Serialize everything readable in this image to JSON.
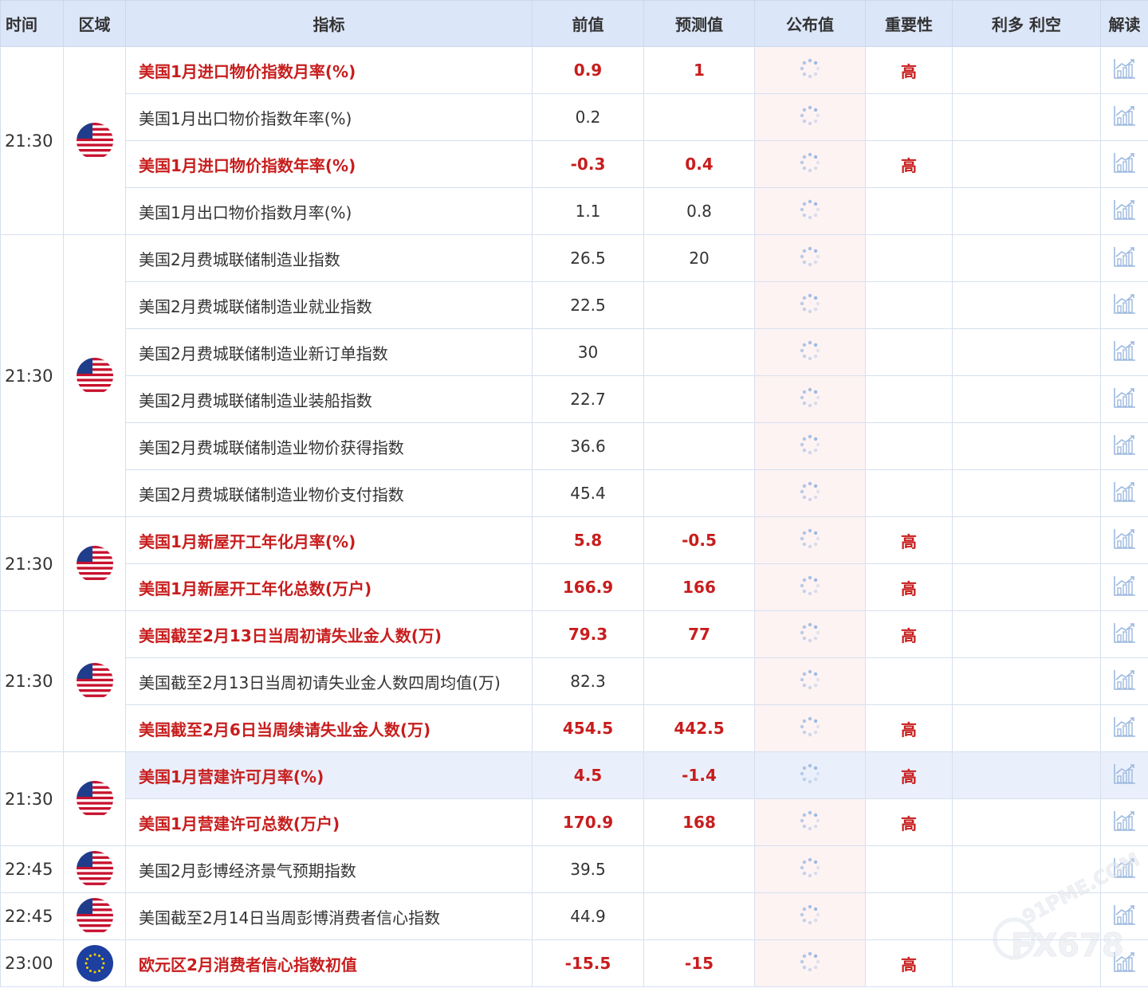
{
  "header": {
    "time": "时间",
    "region": "区域",
    "indicator": "指标",
    "previous": "前值",
    "forecast": "预测值",
    "published": "公布值",
    "importance": "重要性",
    "effect": "利多 利空",
    "interpret": "解读"
  },
  "groups": [
    {
      "time": "21:30",
      "region": "us",
      "rows": [
        {
          "name": "美国1月进口物价指数月率(%)",
          "prev": "0.9",
          "fc": "1",
          "imp": "高",
          "hi": true
        },
        {
          "name": "美国1月出口物价指数年率(%)",
          "prev": "0.2",
          "fc": "",
          "imp": "",
          "hi": false
        },
        {
          "name": "美国1月进口物价指数年率(%)",
          "prev": "-0.3",
          "fc": "0.4",
          "imp": "高",
          "hi": true
        },
        {
          "name": "美国1月出口物价指数月率(%)",
          "prev": "1.1",
          "fc": "0.8",
          "imp": "",
          "hi": false
        }
      ]
    },
    {
      "time": "21:30",
      "region": "us",
      "rows": [
        {
          "name": "美国2月费城联储制造业指数",
          "prev": "26.5",
          "fc": "20",
          "imp": "",
          "hi": false
        },
        {
          "name": "美国2月费城联储制造业就业指数",
          "prev": "22.5",
          "fc": "",
          "imp": "",
          "hi": false
        },
        {
          "name": "美国2月费城联储制造业新订单指数",
          "prev": "30",
          "fc": "",
          "imp": "",
          "hi": false
        },
        {
          "name": "美国2月费城联储制造业装船指数",
          "prev": "22.7",
          "fc": "",
          "imp": "",
          "hi": false
        },
        {
          "name": "美国2月费城联储制造业物价获得指数",
          "prev": "36.6",
          "fc": "",
          "imp": "",
          "hi": false
        },
        {
          "name": "美国2月费城联储制造业物价支付指数",
          "prev": "45.4",
          "fc": "",
          "imp": "",
          "hi": false
        }
      ]
    },
    {
      "time": "21:30",
      "region": "us",
      "rows": [
        {
          "name": "美国1月新屋开工年化月率(%)",
          "prev": "5.8",
          "fc": "-0.5",
          "imp": "高",
          "hi": true
        },
        {
          "name": "美国1月新屋开工年化总数(万户)",
          "prev": "166.9",
          "fc": "166",
          "imp": "高",
          "hi": true
        }
      ]
    },
    {
      "time": "21:30",
      "region": "us",
      "rows": [
        {
          "name": "美国截至2月13日当周初请失业金人数(万)",
          "prev": "79.3",
          "fc": "77",
          "imp": "高",
          "hi": true
        },
        {
          "name": "美国截至2月13日当周初请失业金人数四周均值(万)",
          "prev": "82.3",
          "fc": "",
          "imp": "",
          "hi": false
        },
        {
          "name": "美国截至2月6日当周续请失业金人数(万)",
          "prev": "454.5",
          "fc": "442.5",
          "imp": "高",
          "hi": true
        }
      ]
    },
    {
      "time": "21:30",
      "region": "us",
      "rows": [
        {
          "name": "美国1月营建许可月率(%)",
          "prev": "4.5",
          "fc": "-1.4",
          "imp": "高",
          "hi": true,
          "selected": true
        },
        {
          "name": "美国1月营建许可总数(万户)",
          "prev": "170.9",
          "fc": "168",
          "imp": "高",
          "hi": true
        }
      ]
    },
    {
      "time": "22:45",
      "region": "us",
      "rows": [
        {
          "name": "美国2月彭博经济景气预期指数",
          "prev": "39.5",
          "fc": "",
          "imp": "",
          "hi": false
        }
      ]
    },
    {
      "time": "22:45",
      "region": "us",
      "rows": [
        {
          "name": "美国截至2月14日当周彭博消费者信心指数",
          "prev": "44.9",
          "fc": "",
          "imp": "",
          "hi": false
        }
      ]
    },
    {
      "time": "23:00",
      "region": "eu",
      "rows": [
        {
          "name": "欧元区2月消费者信心指数初值",
          "prev": "-15.5",
          "fc": "-15",
          "imp": "高",
          "hi": true
        }
      ]
    }
  ],
  "watermark": {
    "site": "91PME.COM",
    "brand": "FX678"
  },
  "colors": {
    "highlight": "#c81d1d",
    "header_bg": "#dce6f9",
    "published_bg": "#fdf3f3",
    "selected_bg": "#eaf0fb"
  }
}
